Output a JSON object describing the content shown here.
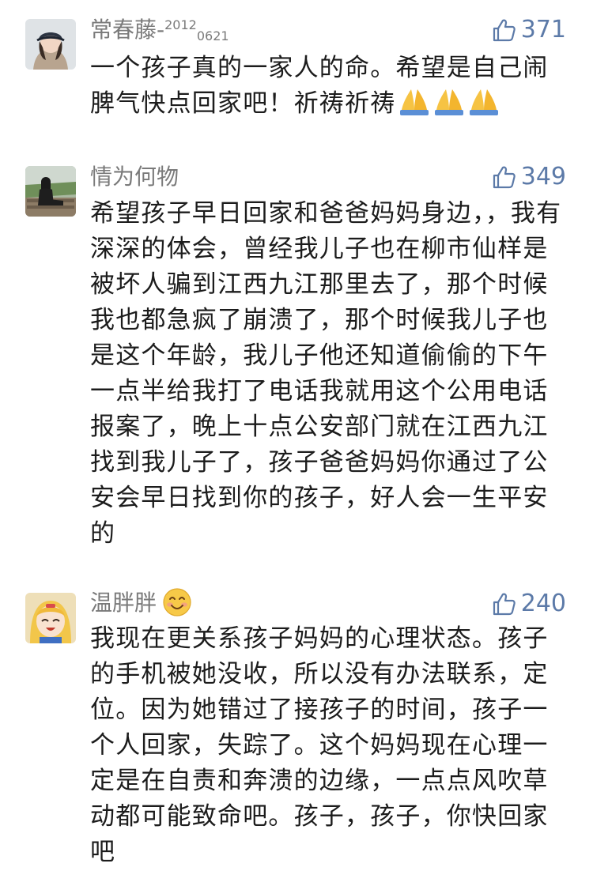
{
  "comments": [
    {
      "username": "常春藤-",
      "username_sup": "2012",
      "username_sub": "0621",
      "likes": "371",
      "text": "一个孩子真的一家人的命。希望是自己闹脾气快点回家吧！祈祷祈祷",
      "trailing_emoji": "folded-hands-icon x3"
    },
    {
      "username": "情为何物",
      "likes": "349",
      "text": "希望孩子早日回家和爸爸妈妈身边，，我有深深的体会，曾经我儿子也在柳市仙样是被坏人骗到江西九江那里去了，那个时候我也都急疯了崩溃了，那个时候我儿子也是这个年龄，我儿子他还知道偷偷的下午一点半给我打了电话我就用这个公用电话报案了，晚上十点公安部门就在江西九江找到我儿子了，孩子爸爸妈妈你通过了公安会早日找到你的孩子，好人会一生平安的"
    },
    {
      "username": "温胖胖",
      "username_emoji": "smiling-face-icon",
      "likes": "240",
      "text": "我现在更关系孩子妈妈的心理状态。孩子的手机被她没收，所以没有办法联系，定位。因为她错过了接孩子的时间，孩子一个人回家，失踪了。这个妈妈现在心理一定是在自责和奔溃的边缘，一点点风吹草动都可能致命吧。孩子，孩子，你快回家吧"
    }
  ],
  "colors": {
    "username": "#7a7a7a",
    "like_accent": "#5c7aa8",
    "body_text": "#1c1c1c",
    "background": "#ffffff"
  }
}
